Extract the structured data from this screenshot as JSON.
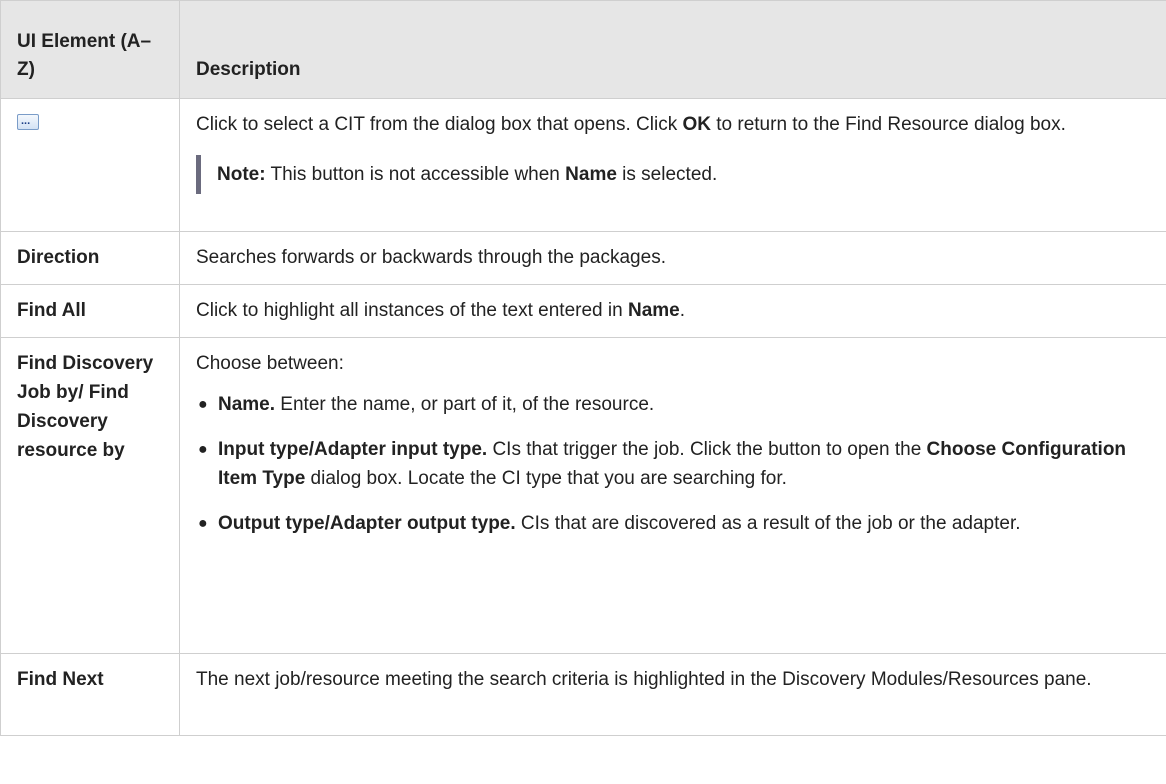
{
  "header": {
    "col1": "UI Element (A–Z)",
    "col2": "Description"
  },
  "icon": {
    "name": "ellipsis-button-icon",
    "glyph": "..."
  },
  "rows": {
    "row1": {
      "desc_a": "Click to select a CIT from the dialog box that opens. Click ",
      "desc_b": "OK",
      "desc_c": " to return to the Find Resource dialog box.",
      "note_label": "Note:",
      "note_a": " This button is not accessible when ",
      "note_b": "Name",
      "note_c": " is selected."
    },
    "row2": {
      "element": "Direction",
      "desc": "Searches forwards or backwards through the packages."
    },
    "row3": {
      "element": "Find All",
      "desc_a": "Click to highlight all instances of the text entered in ",
      "desc_b": "Name",
      "desc_c": "."
    },
    "row4": {
      "element": "Find Discovery Job by/ Find Discovery resource by",
      "intro": "Choose between:",
      "bullets": [
        {
          "bold": "Name.",
          "text": " Enter the name, or part of it, of the resource."
        },
        {
          "bold": "Input type/Adapter input type.",
          "text_a": " CIs that trigger the job. Click the button to open the ",
          "bold2": "Choose Configuration Item Type",
          "text_b": " dialog box. Locate the CI type that you are searching for."
        },
        {
          "bold": "Output type/Adapter output type.",
          "text": " CIs that are discovered as a result of the job or the adapter."
        }
      ]
    },
    "row5": {
      "element": "Find Next",
      "desc": "The next job/resource meeting the search criteria is highlighted in the Discovery Modules/Resources pane."
    }
  }
}
